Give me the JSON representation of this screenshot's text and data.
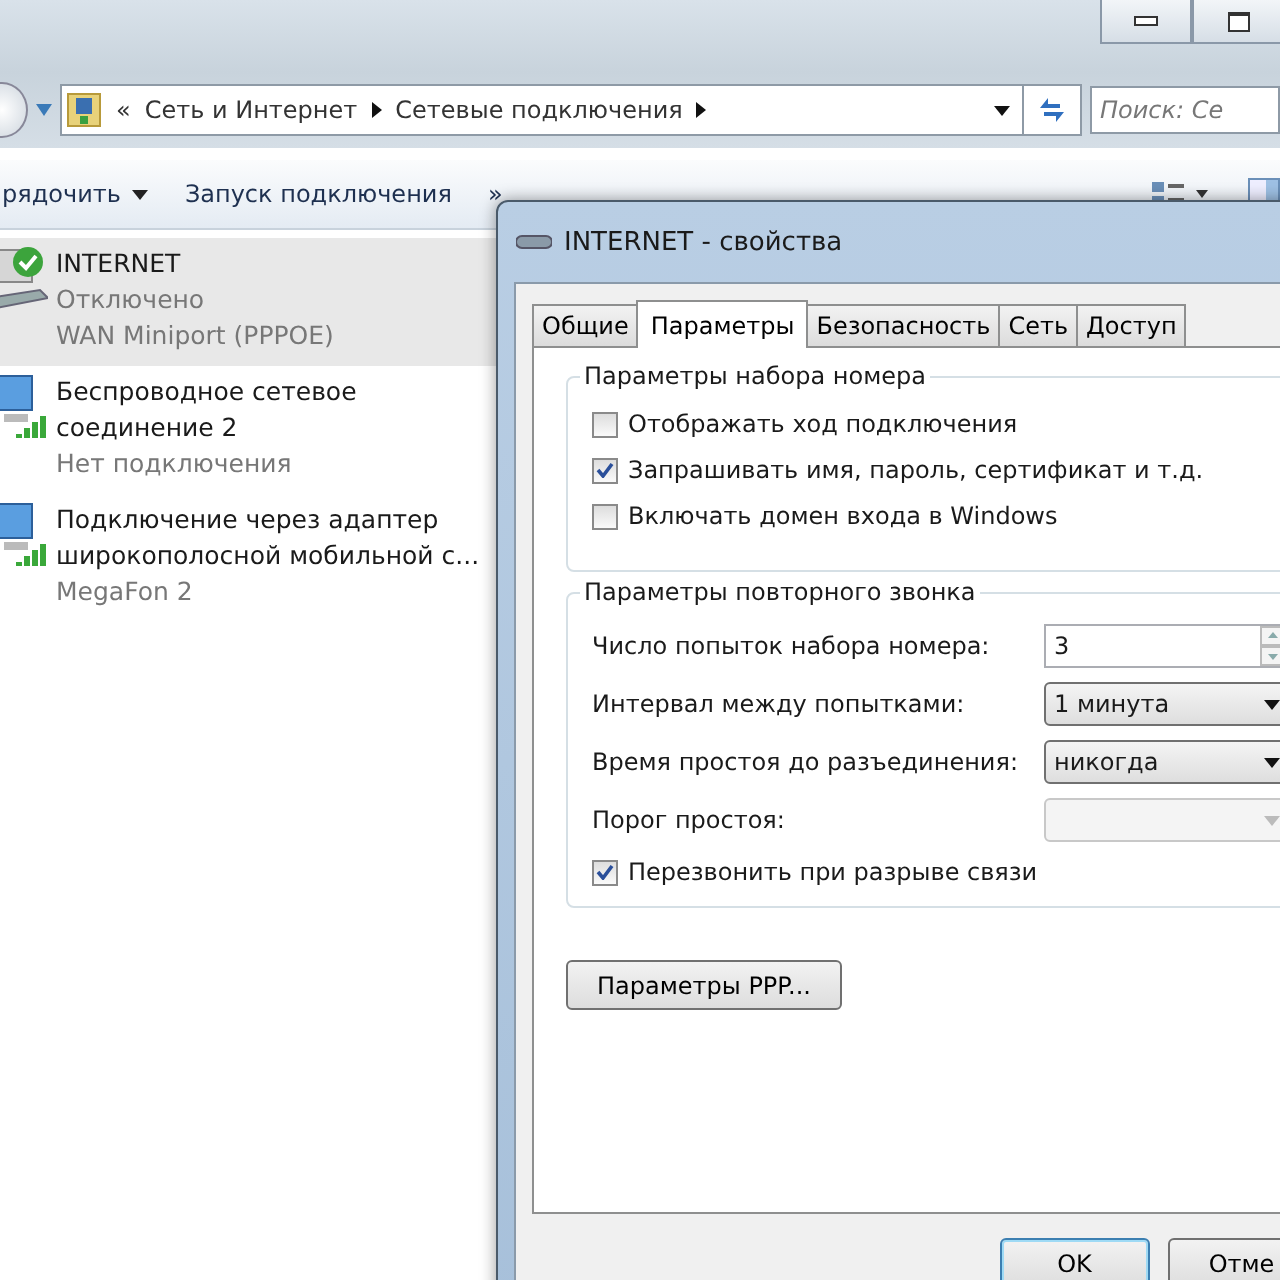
{
  "explorer": {
    "breadcrumb": [
      "«",
      "Сеть и Интернет",
      "Сетевые подключения"
    ],
    "search": {
      "placeholder": "Поиск: Се"
    },
    "toolbar": [
      "рядочить",
      "Запуск подключения",
      "»"
    ],
    "connections": [
      {
        "kind": "dialup",
        "selected": true,
        "default": true,
        "name": [
          "INTERNET"
        ],
        "status": "Отключено",
        "device": "WAN Miniport (PPPOE)"
      },
      {
        "kind": "wireless",
        "selected": false,
        "default": false,
        "name": [
          "Беспроводное сетевое",
          "соединение 2"
        ],
        "status": "Нет подключения"
      },
      {
        "kind": "wireless",
        "selected": false,
        "default": false,
        "name": [
          "Подключение через адаптер",
          "широкополосной мобильной с..."
        ],
        "status": "MegaFon  2"
      }
    ]
  },
  "dialog": {
    "title": "INTERNET - свойства",
    "tabs": [
      {
        "label": "Общие",
        "selected": false
      },
      {
        "label": "Параметры",
        "selected": true
      },
      {
        "label": "Безопасность",
        "selected": false
      },
      {
        "label": "Сеть",
        "selected": false
      },
      {
        "label": "Доступ",
        "selected": false
      }
    ],
    "dial_group": {
      "title": "Параметры набора номера",
      "options": [
        {
          "label": "Отображать ход подключения",
          "checked": false
        },
        {
          "label": "Запрашивать имя, пароль, сертификат и т.д.",
          "checked": true
        },
        {
          "label": "Включать домен входа в Windows",
          "checked": false
        }
      ]
    },
    "redial_group": {
      "title": "Параметры повторного звонка",
      "fields": [
        {
          "kind": "spin",
          "label": "Число попыток набора номера:",
          "value": "3",
          "disabled": false
        },
        {
          "kind": "combo",
          "label": "Интервал между попытками:",
          "value": "1 минута",
          "disabled": false
        },
        {
          "kind": "combo",
          "label": "Время простоя до разъединения:",
          "value": "никогда",
          "disabled": false
        },
        {
          "kind": "combo",
          "label": "Порог простоя:",
          "disabled": true
        }
      ],
      "option": {
        "label": "Перезвонить при разрыве связи",
        "checked": true
      }
    },
    "ppp_button": "Параметры PPP...",
    "buttons": [
      {
        "label": "OK",
        "default": true
      },
      {
        "label": "Отме",
        "default": false
      }
    ]
  }
}
